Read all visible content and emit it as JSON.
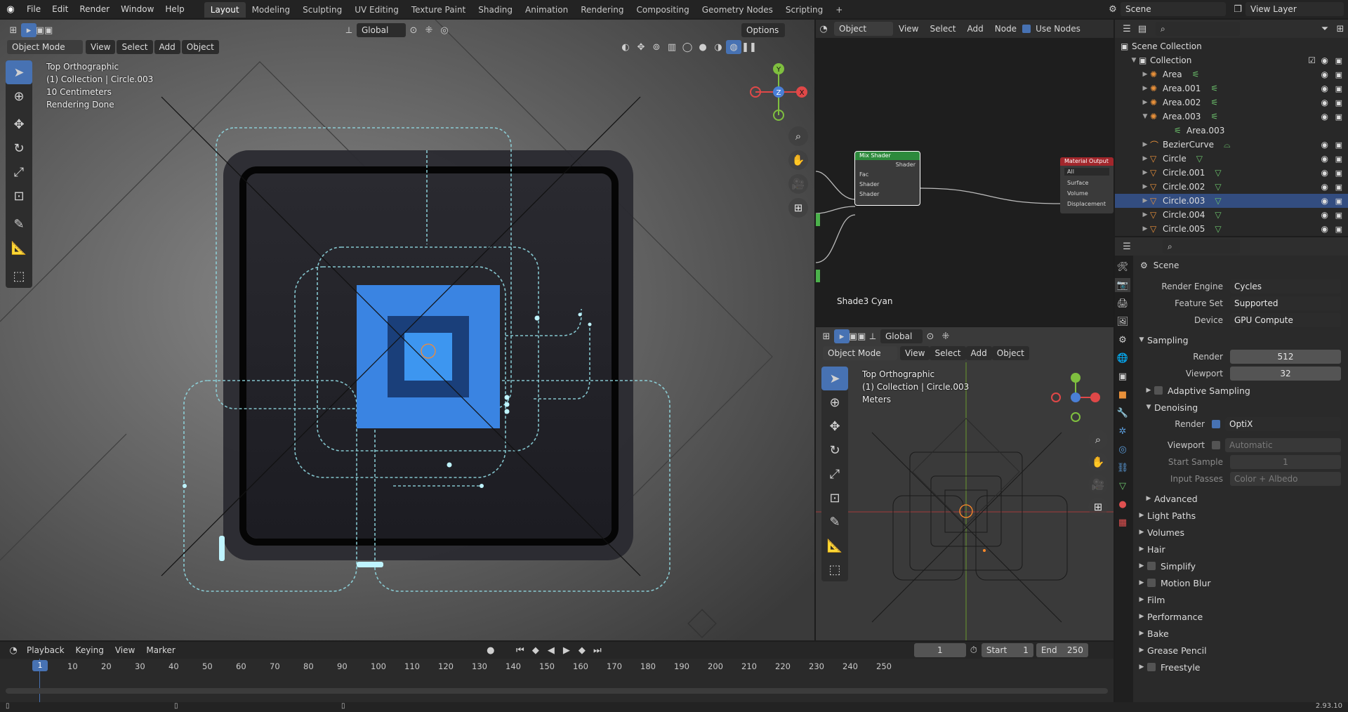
{
  "topbar": {
    "menus": [
      "File",
      "Edit",
      "Render",
      "Window",
      "Help"
    ],
    "workspaces": [
      "Layout",
      "Modeling",
      "Sculpting",
      "UV Editing",
      "Texture Paint",
      "Shading",
      "Animation",
      "Rendering",
      "Compositing",
      "Geometry Nodes",
      "Scripting"
    ],
    "active_workspace": "Layout",
    "add_tab": "+",
    "scene_name": "Scene",
    "view_layer": "View Layer"
  },
  "main_viewport": {
    "header": {
      "transform": "Global",
      "options": "Options"
    },
    "mode": "Object Mode",
    "menus": [
      "View",
      "Select",
      "Add",
      "Object"
    ],
    "overlay_lines": [
      "Top Orthographic",
      "(1) Collection | Circle.003",
      "10 Centimeters",
      "Rendering Done"
    ],
    "gizmo": {
      "x": "X",
      "y": "Y",
      "z": "Z"
    }
  },
  "node_editor": {
    "type": "Object",
    "menus": [
      "View",
      "Select",
      "Add",
      "Node"
    ],
    "use_nodes": "Use Nodes",
    "material_name": "Shade3 Cyan",
    "mix_shader": {
      "title": "Mix Shader",
      "out": "Shader",
      "inputs": [
        "Fac",
        "Shader",
        "Shader"
      ]
    },
    "material_output": {
      "title": "Material Output",
      "target": "All",
      "inputs": [
        "Surface",
        "Volume",
        "Displacement"
      ]
    }
  },
  "small_viewport": {
    "transform": "Global",
    "mode": "Object Mode",
    "menus": [
      "View",
      "Select",
      "Add",
      "Object"
    ],
    "overlay_lines": [
      "Top Orthographic",
      "(1) Collection | Circle.003",
      "Meters"
    ]
  },
  "outliner": {
    "root": "Scene Collection",
    "collection": "Collection",
    "items": [
      {
        "name": "Area",
        "type": "light"
      },
      {
        "name": "Area.001",
        "type": "light"
      },
      {
        "name": "Area.002",
        "type": "light"
      },
      {
        "name": "Area.003",
        "type": "light",
        "expanded": true,
        "child": "Area.003"
      },
      {
        "name": "BezierCurve",
        "type": "curve"
      },
      {
        "name": "Circle",
        "type": "mesh"
      },
      {
        "name": "Circle.001",
        "type": "mesh"
      },
      {
        "name": "Circle.002",
        "type": "mesh"
      },
      {
        "name": "Circle.003",
        "type": "mesh",
        "selected": true
      },
      {
        "name": "Circle.004",
        "type": "mesh"
      },
      {
        "name": "Circle.005",
        "type": "mesh"
      }
    ]
  },
  "properties": {
    "context": "Scene",
    "render_engine": {
      "label": "Render Engine",
      "value": "Cycles"
    },
    "feature_set": {
      "label": "Feature Set",
      "value": "Supported"
    },
    "device": {
      "label": "Device",
      "value": "GPU Compute"
    },
    "sampling": {
      "title": "Sampling",
      "render_label": "Render",
      "render_value": "512",
      "viewport_label": "Viewport",
      "viewport_value": "32",
      "adaptive": "Adaptive Sampling",
      "denoising": "Denoising",
      "den_render_label": "Render",
      "den_render_value": "OptiX",
      "den_viewport_label": "Viewport",
      "den_viewport_value": "Automatic",
      "start_sample_label": "Start Sample",
      "start_sample_value": "1",
      "input_passes_label": "Input Passes",
      "input_passes_value": "Color + Albedo",
      "advanced": "Advanced"
    },
    "sections": [
      "Light Paths",
      "Volumes",
      "Hair",
      "Simplify",
      "Motion Blur",
      "Film",
      "Performance",
      "Bake",
      "Grease Pencil",
      "Freestyle"
    ]
  },
  "timeline": {
    "menus": [
      "Playback",
      "Keying",
      "View",
      "Marker"
    ],
    "current_frame": "1",
    "start_label": "Start",
    "start": "1",
    "end_label": "End",
    "end": "250",
    "ticks": [
      "10",
      "20",
      "30",
      "40",
      "50",
      "60",
      "70",
      "80",
      "90",
      "100",
      "110",
      "120",
      "130",
      "140",
      "150",
      "160",
      "170",
      "180",
      "190",
      "200",
      "210",
      "220",
      "230",
      "240",
      "250"
    ],
    "playhead": "1"
  },
  "statusbar": {
    "version": "2.93.10"
  }
}
